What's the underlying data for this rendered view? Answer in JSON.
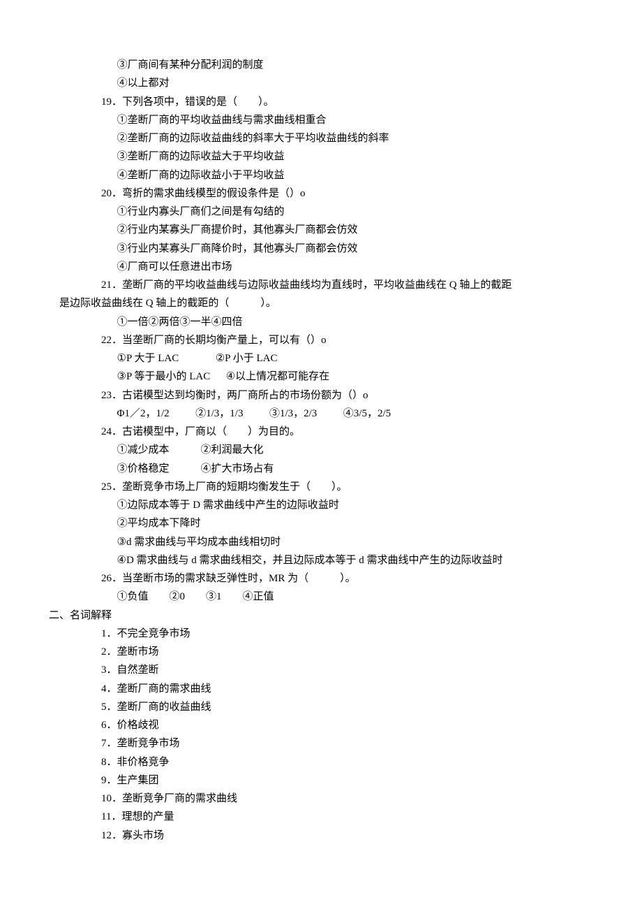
{
  "q18": {
    "opt3": "③厂商间有某种分配利润的制度",
    "opt4": "④以上都对"
  },
  "q19": {
    "text": "19．下列各项中，错误的是（　　）。",
    "opt1": "①垄断厂商的平均收益曲线与需求曲线相重合",
    "opt2": "②垄断厂商的边际收益曲线的斜率大于平均收益曲线的斜率",
    "opt3": "③垄断厂商的边际收益大于平均收益",
    "opt4": "④垄断厂商的边际收益小于平均收益"
  },
  "q20": {
    "text": "20．弯折的需求曲线模型的假设条件是（）o",
    "opt1": "①行业内寡头厂商们之间是有勾结的",
    "opt2": "②行业内某寡头厂商提价时，其他寡头厂商都会仿效",
    "opt3": "③行业内某寡头厂商降价时，其他寡头厂商都会仿效",
    "opt4": "④厂商可以任意进出市场"
  },
  "q21": {
    "line1": "21．垄断厂商的平均收益曲线与边际收益曲线均为直线时，平均收益曲线在 Q 轴上的截距",
    "line2": "是边际收益曲线在 Q 轴上的截距的（　　　）。",
    "opts": "①一倍②两倍③一半④四倍"
  },
  "q22": {
    "text": "22．当垄断厂商的长期均衡产量上，可以有（）o",
    "row1": "①P 大于 LAC              ②P 小于 LAC",
    "row2": "③P 等于最小的 LAC      ④以上情况都可能存在"
  },
  "q23": {
    "text": "23．古诺模型达到均衡时，两厂商所占的市场份额为（）o",
    "opts": "Φ1／2，1/2          ②1/3，1/3          ③1/3，2/3          ④3/5，2/5"
  },
  "q24": {
    "text": "24．古诺模型中，厂商以（　　）为目的。",
    "row1": "①减少成本            ②利润最大化",
    "row2": "③价格稳定            ④扩大市场占有"
  },
  "q25": {
    "text": "25．垄断竞争市场上厂商的短期均衡发生于（　　）。",
    "opt1": "①边际成本等于 D 需求曲线中产生的边际收益时",
    "opt2": "②平均成本下降时",
    "opt3": "③d 需求曲线与平均成本曲线相切时",
    "opt4": "④D 需求曲线与 d 需求曲线相交，并且边际成本等于 d 需求曲线中产生的边际收益时"
  },
  "q26": {
    "text": "26．当垄断市场的需求缺乏弹性时，MR 为（　　　）。",
    "opts": "①负值　　②0　　③1　　④正值"
  },
  "section2": {
    "header": "二、名词解释",
    "items": [
      "1．不完全竞争市场",
      "2．垄断市场",
      "3．自然垄断",
      "4．垄断厂商的需求曲线",
      "5．垄断厂商的收益曲线",
      "6．价格歧视",
      "7．垄断竞争市场",
      "8．非价格竞争",
      "9．生产集团",
      "10．垄断竞争厂商的需求曲线",
      "11．理想的产量",
      "12．寡头市场"
    ]
  }
}
